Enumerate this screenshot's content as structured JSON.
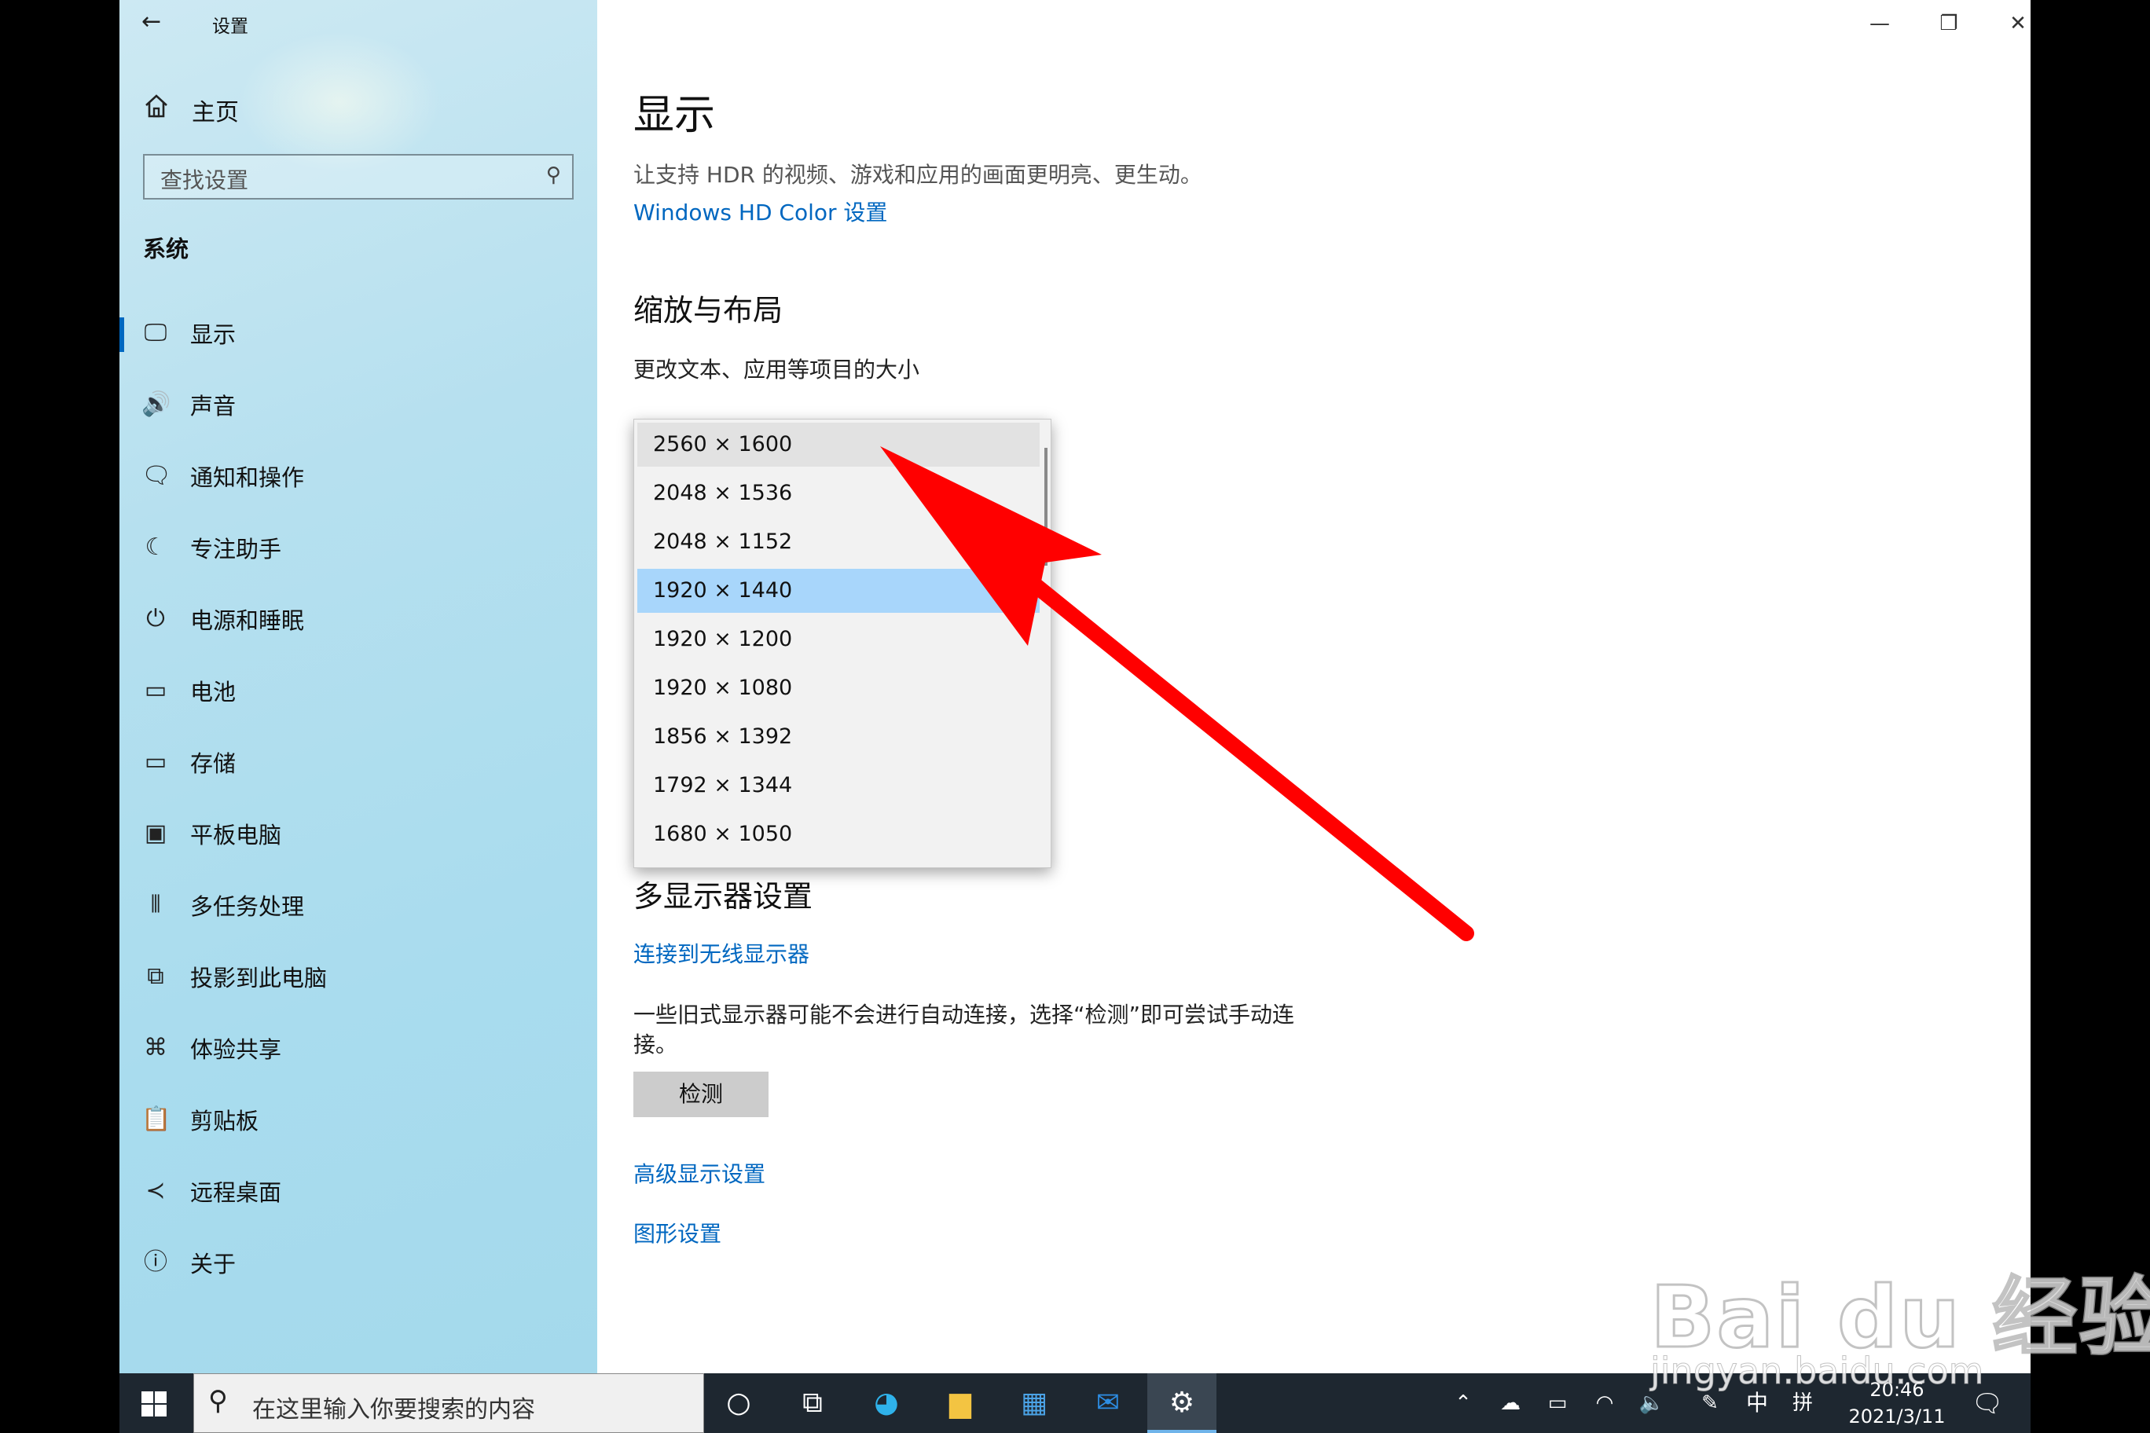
{
  "window": {
    "title": "设置",
    "controls": {
      "minimize": "—",
      "restore": "❐",
      "close": "✕"
    }
  },
  "sidebar": {
    "home_label": "主页",
    "search_placeholder": "查找设置",
    "section_label": "系统",
    "items": [
      {
        "label": "显示",
        "icon": "monitor-icon",
        "glyph": "🖵"
      },
      {
        "label": "声音",
        "icon": "speaker-icon",
        "glyph": "🔊"
      },
      {
        "label": "通知和操作",
        "icon": "notification-icon",
        "glyph": "🗨"
      },
      {
        "label": "专注助手",
        "icon": "moon-icon",
        "glyph": "☾"
      },
      {
        "label": "电源和睡眠",
        "icon": "power-icon",
        "glyph": "⏻"
      },
      {
        "label": "电池",
        "icon": "battery-icon",
        "glyph": "▭"
      },
      {
        "label": "存储",
        "icon": "storage-icon",
        "glyph": "▭"
      },
      {
        "label": "平板电脑",
        "icon": "tablet-icon",
        "glyph": "▣"
      },
      {
        "label": "多任务处理",
        "icon": "multitask-icon",
        "glyph": "⫴"
      },
      {
        "label": "投影到此电脑",
        "icon": "project-icon",
        "glyph": "⧉"
      },
      {
        "label": "体验共享",
        "icon": "share-icon",
        "glyph": "⌘"
      },
      {
        "label": "剪贴板",
        "icon": "clipboard-icon",
        "glyph": "📋"
      },
      {
        "label": "远程桌面",
        "icon": "remote-icon",
        "glyph": "≺"
      },
      {
        "label": "关于",
        "icon": "info-icon",
        "glyph": "ⓘ"
      }
    ]
  },
  "main": {
    "title": "显示",
    "hdr_text": "让支持 HDR 的视频、游戏和应用的画面更明亮、更生动。",
    "hdr_link": "Windows HD Color 设置",
    "scale_heading": "缩放与布局",
    "scale_label": "更改文本、应用等项目的大小",
    "resolution_options": [
      "2560 × 1600",
      "2048 × 1536",
      "2048 × 1152",
      "1920 × 1440",
      "1920 × 1200",
      "1920 × 1080",
      "1856 × 1392",
      "1792 × 1344",
      "1680 × 1050"
    ],
    "selected_option": "1920 × 1440",
    "multi_heading": "多显示器设置",
    "wireless_link": "连接到无线显示器",
    "detect_text_1": "一些旧式显示器可能不会进行自动连接，选择“检测”即可尝试手动连",
    "detect_text_2": "接。",
    "detect_button": "检测",
    "advanced_link": "高级显示设置",
    "graphics_link": "图形设置"
  },
  "taskbar": {
    "search_placeholder": "在这里输入你要搜索的内容",
    "ime_label": "中",
    "ime_mode": "拼",
    "time": "20:46",
    "date": "2021/3/11"
  },
  "watermark": {
    "brand": "Bai du 经验",
    "url": "jingyan.baidu.com"
  },
  "colors": {
    "accent": "#0067c0",
    "selected": "#a8d6fb",
    "arrow": "#ff0000",
    "taskbar": "#1e2730"
  }
}
